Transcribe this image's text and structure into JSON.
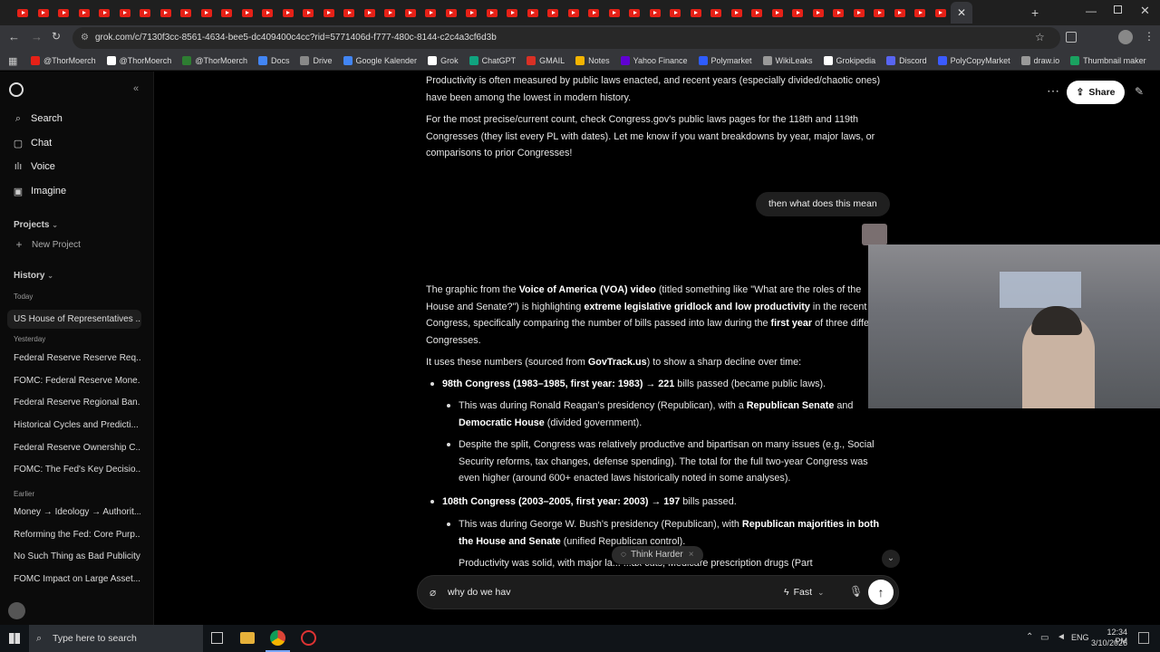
{
  "browser": {
    "url": "grok.com/c/7130f3cc-8561-4634-bee5-dc409400c4cc?rid=5771406d-f777-480c-8144-c2c4a3cf6d3b",
    "bookmarks": [
      "@ThorMoerch",
      "@ThorMoerch",
      "@ThorMoerch",
      "Docs",
      "Drive",
      "Google Kalender",
      "Grok",
      "ChatGPT",
      "GMAIL",
      "Notes",
      "Yahoo Finance",
      "Polymarket",
      "WikiLeaks",
      "Grokipedia",
      "Discord",
      "PolyCopyMarket",
      "draw.io",
      "Thumbnail maker"
    ]
  },
  "sidebar": {
    "nav": [
      "Search",
      "Chat",
      "Voice",
      "Imagine"
    ],
    "projects_label": "Projects",
    "new_project": "New Project",
    "history_label": "History",
    "today_label": "Today",
    "today_items": [
      "US House of Representatives ..."
    ],
    "yesterday_label": "Yesterday",
    "yesterday_items": [
      "Federal Reserve Reserve Req...",
      "FOMC: Federal Reserve Mone...",
      "Federal Reserve Regional Ban...",
      "Historical Cycles and Predicti...",
      "Federal Reserve Ownership C...",
      "FOMC: The Fed's Key Decisio..."
    ],
    "earlier_label": "Earlier",
    "earlier_items": [
      "Money → Ideology → Authorit...",
      "Reforming the Fed: Core Purp...",
      "No Such Thing as Bad Publicity",
      "FOMC Impact on Large Asset..."
    ]
  },
  "header": {
    "share": "Share"
  },
  "chat": {
    "prev_p1": "Productivity is often measured by public laws enacted, and recent years (especially divided/chaotic ones) have been among the lowest in modern history.",
    "prev_p2": "For the most precise/current count, check Congress.gov's public laws pages for the 118th and 119th Congresses (they list every PL with dates). Let me know if you want breakdowns by year, major laws, or comparisons to prior Congresses!",
    "user_msg": "then what does this mean",
    "resp_intro_a": "The graphic from the ",
    "resp_intro_b": "Voice of America (VOA) video",
    "resp_intro_c": " (titled something like \"What are the roles of the House and Senate?\") is highlighting ",
    "resp_intro_d": "extreme legislative gridlock and low productivity",
    "resp_intro_e": " in the recent Congress, specifically comparing the number of bills passed into law during the ",
    "resp_intro_f": "first year",
    "resp_intro_g": " of three different Congresses.",
    "uses_a": "It uses these numbers (sourced from ",
    "uses_b": "GovTrack.us",
    "uses_c": ") to show a sharp decline over time:",
    "b1_a": "98th Congress (1983–1985, first year: 1983) → 221",
    "b1_b": " bills passed (became public laws).",
    "b1_s1_a": "This was during Ronald Reagan's presidency (Republican), with a ",
    "b1_s1_b": "Republican Senate",
    "b1_s1_c": " and ",
    "b1_s1_d": "Democratic House",
    "b1_s1_e": " (divided government).",
    "b1_s2": "Despite the split, Congress was relatively productive and bipartisan on many issues (e.g., Social Security reforms, tax changes, defense spending). The total for the full two-year Congress was even higher (around 600+ enacted laws historically noted in some analyses).",
    "b2_a": "108th Congress (2003–2005, first year: 2003) → 197",
    "b2_b": " bills passed.",
    "b2_s1_a": "This was during George W. Bush's presidency (Republican), with ",
    "b2_s1_b": "Republican majorities in both the House and Senate",
    "b2_s1_c": " (unified Republican control).",
    "b2_s2": "Productivity was solid, with major la... ...ax cuts, Medicare prescription drugs (Part"
  },
  "composer": {
    "think_harder": "Think Harder",
    "input_value": "why do we hav",
    "mode": "Fast"
  },
  "taskbar": {
    "search_placeholder": "Type here to search",
    "lang": "ENG",
    "time": "12:34 PM",
    "date": "3/10/2026"
  }
}
